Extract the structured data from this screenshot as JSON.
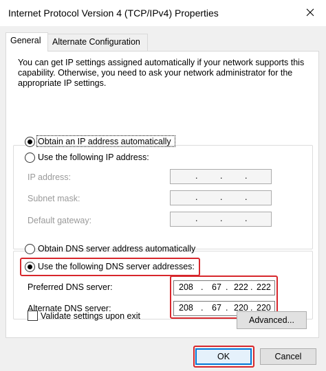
{
  "window": {
    "title": "Internet Protocol Version 4 (TCP/IPv4) Properties",
    "close_icon": "close-icon"
  },
  "tabs": [
    {
      "label": "General",
      "selected": true
    },
    {
      "label": "Alternate Configuration",
      "selected": false
    }
  ],
  "general": {
    "description": "You can get IP settings assigned automatically if your network supports this capability. Otherwise, you need to ask your network administrator for the appropriate IP settings.",
    "ip_auto_label": "Obtain an IP address automatically",
    "ip_manual_label": "Use the following IP address:",
    "ip_address_label": "IP address:",
    "subnet_mask_label": "Subnet mask:",
    "default_gateway_label": "Default gateway:",
    "dns_auto_label": "Obtain DNS server address automatically",
    "dns_manual_label": "Use the following DNS server addresses:",
    "preferred_dns_label": "Preferred DNS server:",
    "preferred_dns": [
      "208",
      "67",
      "222",
      "222"
    ],
    "alternate_dns_label": "Alternate DNS server:",
    "alternate_dns": [
      "208",
      "67",
      "220",
      "220"
    ],
    "validate_label": "Validate settings upon exit",
    "advanced_label": "Advanced..."
  },
  "buttons": {
    "ok": "OK",
    "cancel": "Cancel"
  },
  "colors": {
    "highlight_red": "#d7262b",
    "ok_border": "#0078d7"
  }
}
